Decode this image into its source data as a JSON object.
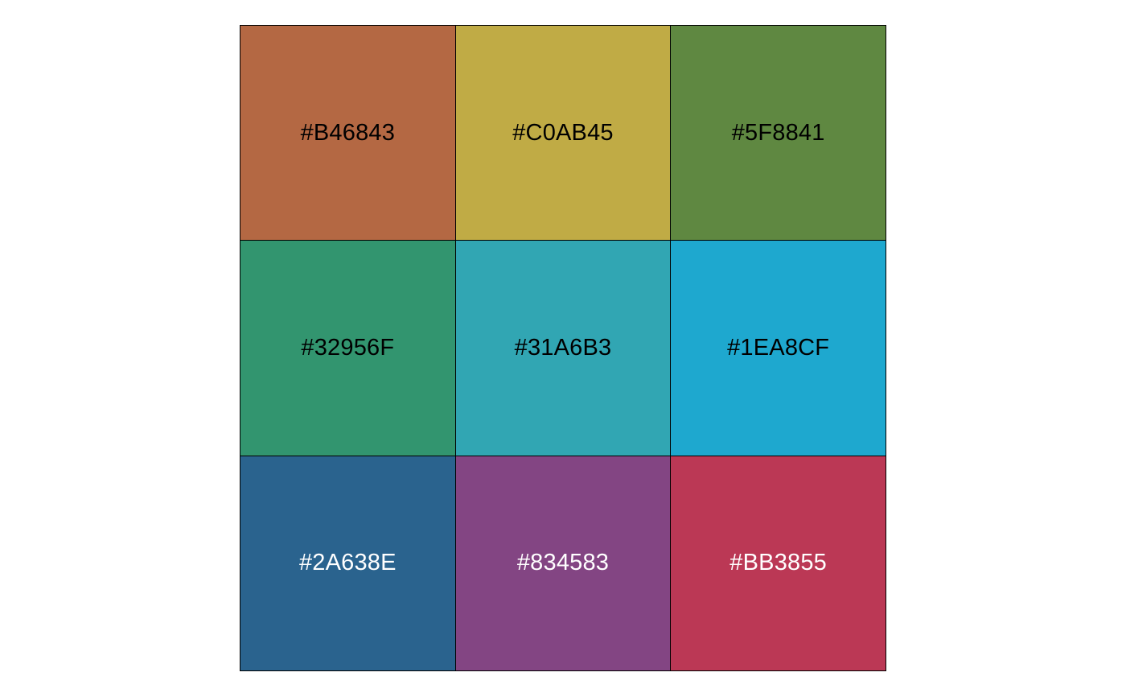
{
  "swatches": [
    {
      "hex": "#B46843",
      "label": "#B46843",
      "text_color": "#000000"
    },
    {
      "hex": "#C0AB45",
      "label": "#C0AB45",
      "text_color": "#000000"
    },
    {
      "hex": "#5F8841",
      "label": "#5F8841",
      "text_color": "#000000"
    },
    {
      "hex": "#32956F",
      "label": "#32956F",
      "text_color": "#000000"
    },
    {
      "hex": "#31A6B3",
      "label": "#31A6B3",
      "text_color": "#000000"
    },
    {
      "hex": "#1EA8CF",
      "label": "#1EA8CF",
      "text_color": "#000000"
    },
    {
      "hex": "#2A638E",
      "label": "#2A638E",
      "text_color": "#FFFFFF"
    },
    {
      "hex": "#834583",
      "label": "#834583",
      "text_color": "#FFFFFF"
    },
    {
      "hex": "#BB3855",
      "label": "#BB3855",
      "text_color": "#FFFFFF"
    }
  ]
}
